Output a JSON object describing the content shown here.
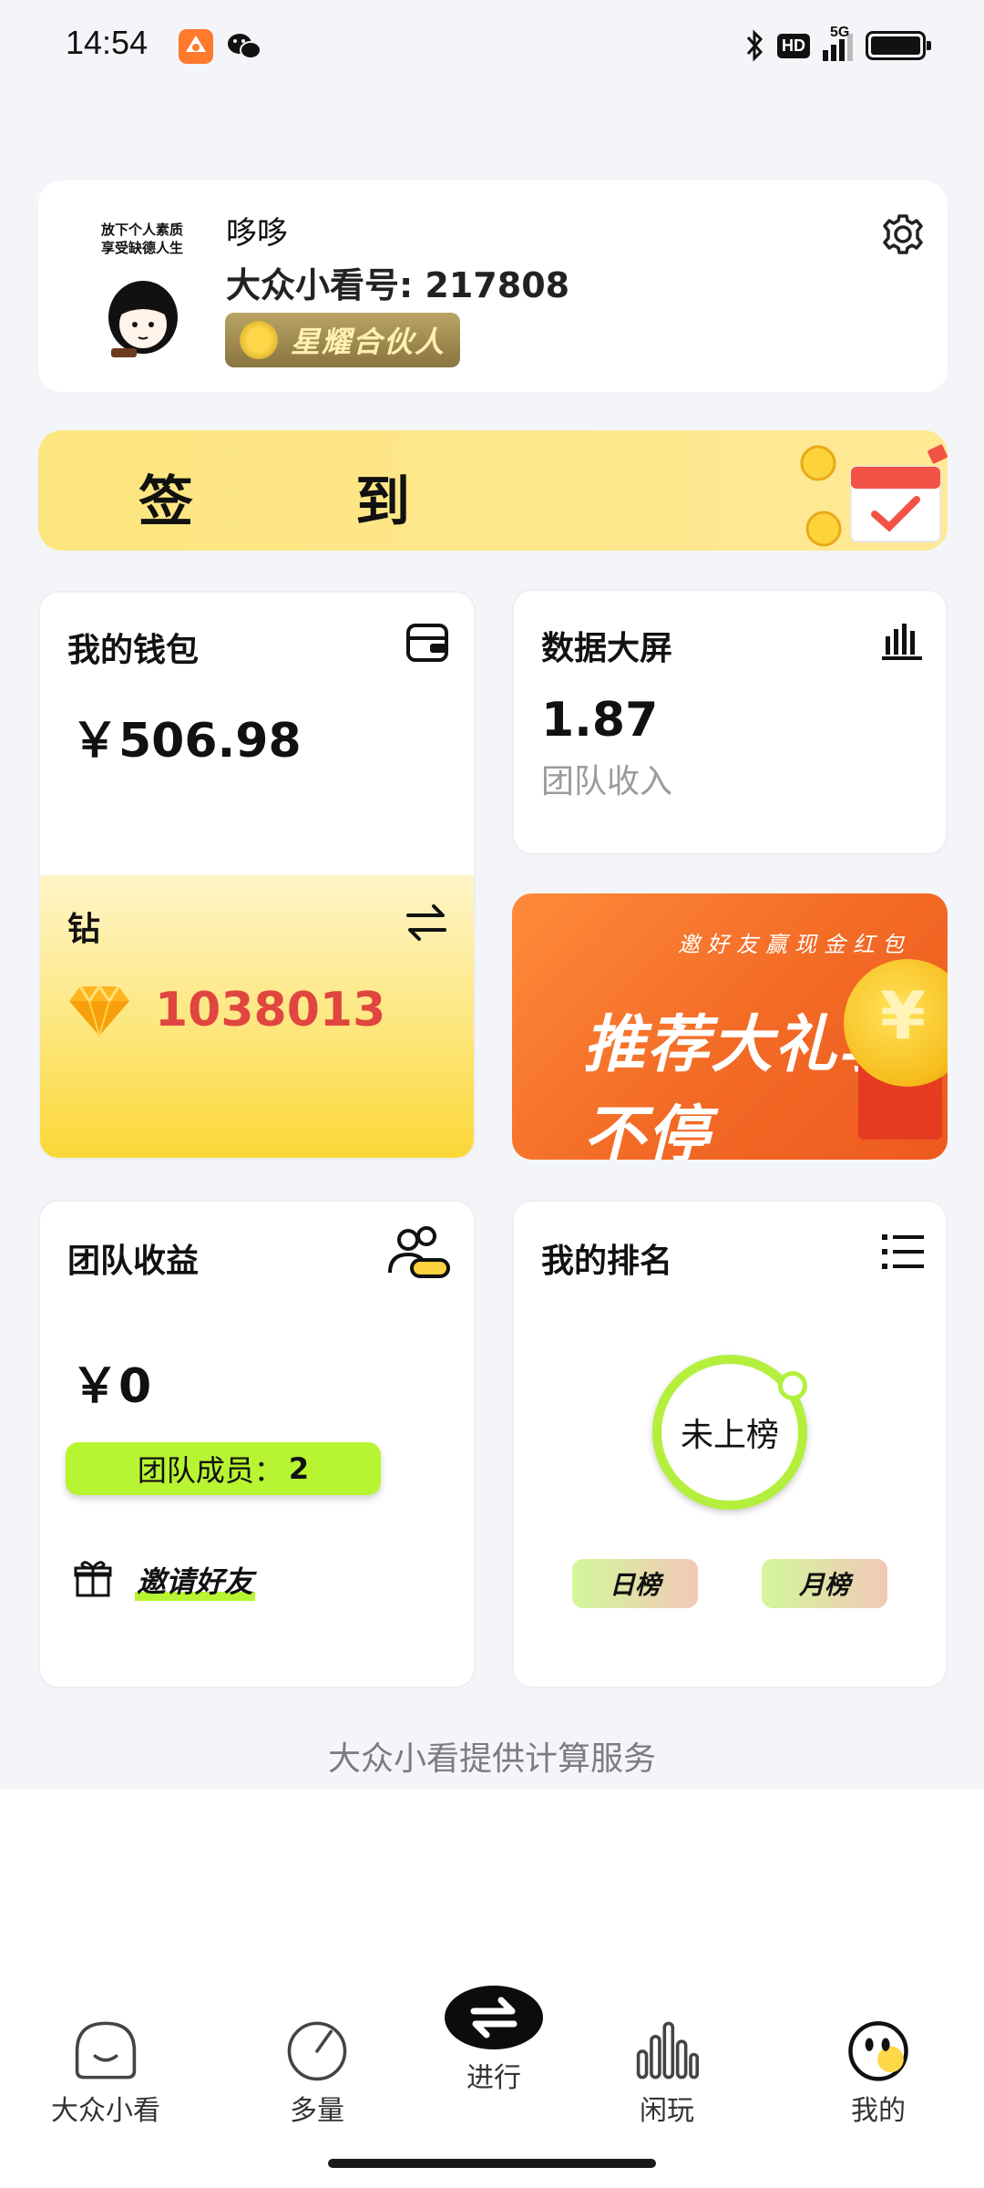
{
  "status_bar": {
    "time": "14:54",
    "hd": "HD",
    "network": "5G",
    "icons": [
      "app-orange-icon",
      "wechat-icon",
      "bluetooth-icon",
      "signal-icon",
      "battery-icon"
    ]
  },
  "profile": {
    "avatar_caption_line1": "放下个人素质",
    "avatar_caption_line2": "享受缺德人生",
    "nickname": "哆哆",
    "user_id": "大众小看号: 217808",
    "partner_badge": "星耀合伙人"
  },
  "checkin": {
    "label": "签到"
  },
  "wallet": {
    "title": "我的钱包",
    "amount": "￥506.98",
    "diamond_title": "钻",
    "diamond_amount": "1038013"
  },
  "data_screen": {
    "title": "数据大屏",
    "value": "1.87",
    "label": "团队收入"
  },
  "promo": {
    "small_text": "邀好友赢现金红包",
    "big_text": "推荐大礼享不停"
  },
  "team": {
    "title": "团队收益",
    "amount": "￥0",
    "members_label": "团队成员：",
    "members_count": "2",
    "invite": "邀请好友"
  },
  "ranking": {
    "title": "我的排名",
    "status": "未上榜",
    "daily": "日榜",
    "monthly": "月榜"
  },
  "footer_note": "大众小看提供计算服务",
  "nav": {
    "home": "大众小看",
    "multi": "多量",
    "center": "进行",
    "idle": "闲玩",
    "mine": "我的"
  },
  "colors": {
    "accent_green": "#b7f431",
    "checkin_yellow": "#fde57f",
    "diamond_red": "#e0453f",
    "promo_orange": "#f26a25"
  }
}
